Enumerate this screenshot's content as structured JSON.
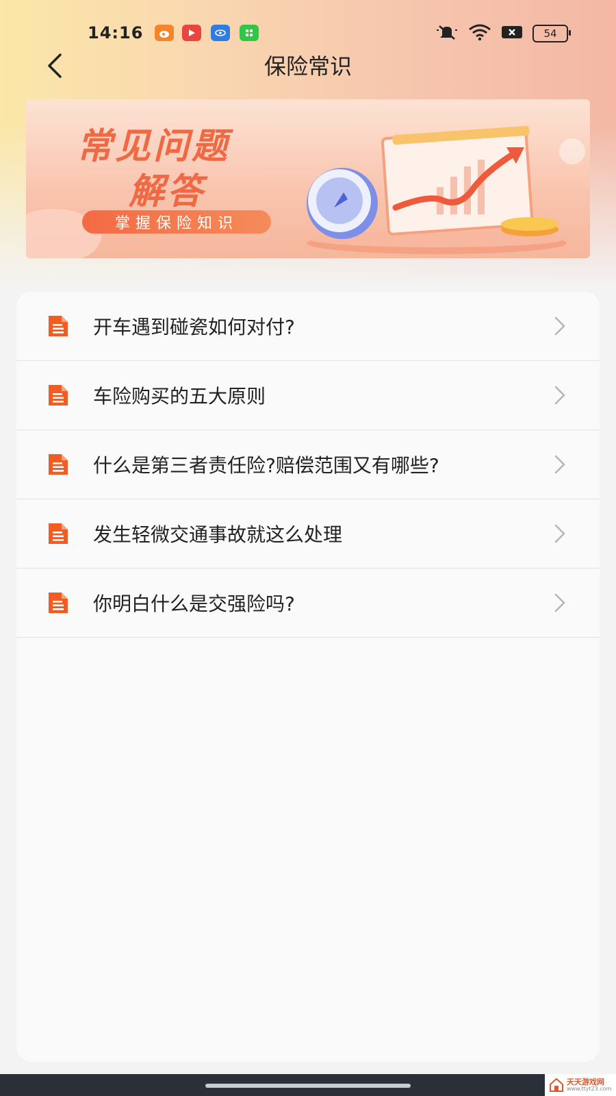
{
  "status_bar": {
    "time": "14:16",
    "battery": "54",
    "app_icons": [
      "weibo-icon",
      "video-icon",
      "browser-icon",
      "shop-icon"
    ],
    "system_icons": [
      "mute-icon",
      "wifi-icon",
      "sim-off-icon",
      "battery-icon"
    ]
  },
  "nav": {
    "title": "保险常识",
    "back_icon": "chevron-left-icon"
  },
  "banner": {
    "title_line1": "常见问题",
    "title_line2": "解答",
    "pill": "掌握保险知识"
  },
  "list": {
    "items": [
      {
        "label": "开车遇到碰瓷如何对付?"
      },
      {
        "label": "车险购买的五大原则"
      },
      {
        "label": "什么是第三者责任险?赔偿范围又有哪些?"
      },
      {
        "label": "发生轻微交通事故就这么处理"
      },
      {
        "label": "你明白什么是交强险吗?"
      }
    ]
  },
  "watermark": {
    "line1": "天天游戏网",
    "line2": "www.ttyt23.com"
  },
  "colors": {
    "accent": "#f25c22",
    "banner_text": "#ef6a44"
  }
}
